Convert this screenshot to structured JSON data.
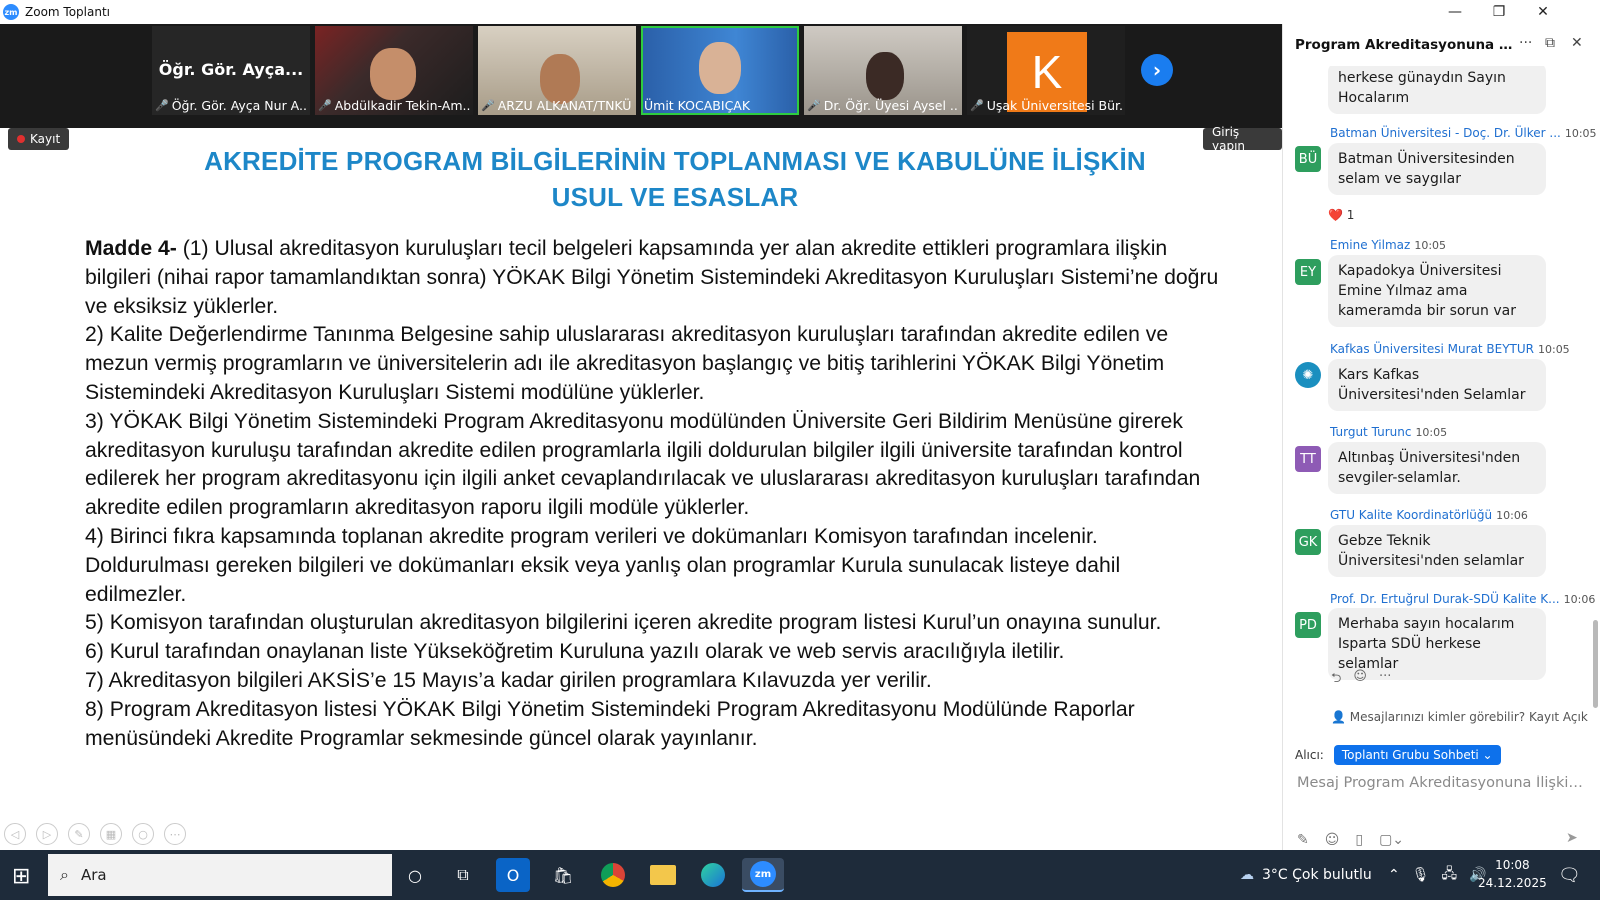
{
  "window": {
    "app_icon_text": "zm",
    "title": "Zoom Toplantı",
    "minimize": "—",
    "restore": "❐",
    "close": "✕"
  },
  "strip": {
    "tiles": [
      {
        "name": "Öğr. Gör. Ayça Nur A...",
        "big": "Öğr. Gör. Ayça...",
        "muted": true
      },
      {
        "name": "Abdülkadir Tekin-Am...",
        "muted": true
      },
      {
        "name": "ARZU ALKANAT/TNKÜ",
        "muted": true
      },
      {
        "name": "Ümit KOCABIÇAK",
        "muted": false,
        "active": true
      },
      {
        "name": "Dr. Öğr. Üyesi Aysel ...",
        "muted": true
      },
      {
        "name": "Uşak Üniversitesi Bür...",
        "muted": true,
        "initial": "K"
      }
    ],
    "next_glyph": "›"
  },
  "share": {
    "record_label": "Kayıt",
    "login_label": "Giriş yapın",
    "title_line1": "AKREDİTE PROGRAM BİLGİLERİNİN TOPLANMASI VE KABULÜNE İLİŞKİN",
    "title_line2": "USUL VE ESASLAR",
    "madde_label": "Madde 4-",
    "paragraphs": [
      " (1) Ulusal akreditasyon kuruluşları tecil belgeleri kapsamında yer alan akredite ettikleri programlara ilişkin bilgileri (nihai rapor tamamlandıktan sonra) YÖKAK Bilgi Yönetim Sistemindeki Akreditasyon Kuruluşları Sistemi’ne doğru ve eksiksiz yüklerler.",
      "2) Kalite Değerlendirme Tanınma Belgesine sahip uluslararası akreditasyon kuruluşları tarafından akredite edilen ve mezun vermiş programların ve üniversitelerin adı ile akreditasyon başlangıç ve bitiş tarihlerini YÖKAK Bilgi Yönetim Sistemindeki Akreditasyon Kuruluşları Sistemi modülüne yüklerler.",
      "3) YÖKAK Bilgi Yönetim Sistemindeki Program Akreditasyonu modülünden Üniversite Geri Bildirim Menüsüne girerek akreditasyon kuruluşu tarafından akredite edilen programlarla ilgili doldurulan bilgiler ilgili üniversite tarafından kontrol edilerek her program akreditasyonu için ilgili anket cevaplandırılacak ve uluslararası akreditasyon kuruluşları tarafından akredite edilen programların akreditasyon raporu ilgili modüle yüklerler.",
      "4) Birinci fıkra kapsamında toplanan akredite program verileri ve dokümanları Komisyon tarafından incelenir. Doldurulması gereken bilgileri ve dokümanları eksik veya yanlış olan programlar Kurula sunulacak listeye dahil edilmezler.",
      "5) Komisyon tarafından oluşturulan akreditasyon bilgilerini içeren akredite program listesi Kurul’un onayına sunulur.",
      "6) Kurul tarafından onaylanan liste Yükseköğretim Kuruluna yazılı olarak ve web servis aracılığıyla iletilir.",
      "7) Akreditasyon bilgileri AKSİS’e 15 Mayıs’a kadar girilen programlara Kılavuzda yer verilir.",
      "8) Program Akreditasyon listesi YÖKAK Bilgi Yönetim Sistemindeki Program Akreditasyonu Modülünde Raporlar menüsündeki Akredite Programlar sekmesinde güncel olarak yayınlanır."
    ]
  },
  "chat": {
    "title": "Program Akreditasyonuna İlişkin...",
    "more_glyph": "···",
    "popout_glyph": "⧉",
    "close_glyph": "✕",
    "partial_bubble": "herkese günaydın Sayın Hocalarım",
    "messages": [
      {
        "sender": "Batman Üniversitesi - Doç. Dr. Ülker ...",
        "time": "10:05",
        "initials": "BÜ",
        "color": "#2e9e5e",
        "text": "Batman Üniversitesinden selam ve saygılar",
        "reaction": "❤️ 1"
      },
      {
        "sender": "Emine Yilmaz",
        "time": "10:05",
        "initials": "EY",
        "color": "#2e9e5e",
        "text": "Kapadokya Üniversitesi Emine Yılmaz ama kameramda bir sorun var"
      },
      {
        "sender": "Kafkas Üniversitesi Murat BEYTUR",
        "time": "10:05",
        "initials": "✺",
        "color": "#1a8fbf",
        "text": "Kars Kafkas Üniversitesi'nden Selamlar"
      },
      {
        "sender": "Turgut Turunc",
        "time": "10:05",
        "initials": "TT",
        "color": "#8e5bb5",
        "text": "Altınbaş Üniversitesi'nden sevgiler-selamlar."
      },
      {
        "sender": "GTU Kalite Koordinatörlüğü",
        "time": "10:06",
        "initials": "GK",
        "color": "#2e9e5e",
        "text": "Gebze Teknik Üniversitesi'nden selamlar"
      },
      {
        "sender": "Prof. Dr. Ertuğrul Durak-SDÜ Kalite K...",
        "time": "10:06",
        "initials": "PD",
        "color": "#2e9e5e",
        "text": "Merhaba sayın hocalarım Isparta SDÜ herkese selamlar"
      }
    ],
    "visibility_note": "Mesajlarınızı kimler görebilir? Kayıt Açık",
    "recipient_label": "Alıcı:",
    "recipient_value": "Toplantı Grubu Sohbeti ⌄",
    "compose_placeholder": "Mesaj Program Akreditasyonuna İlişkin Bil..."
  },
  "taskbar": {
    "search_placeholder": "Ara",
    "weather": "3°C  Çok bulutlu",
    "time": "10:08",
    "date": "24.12.2025"
  }
}
